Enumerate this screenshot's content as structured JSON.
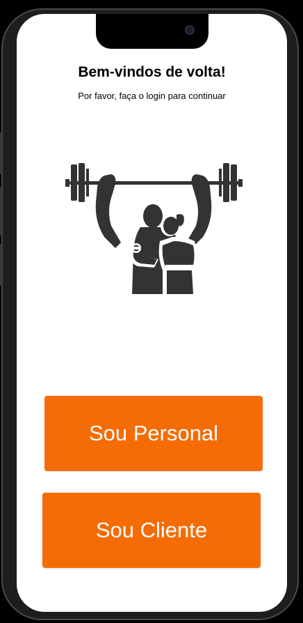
{
  "welcome": {
    "title": "Bem-vindos de volta!",
    "subtitle": "Por favor, faça o login para continuar"
  },
  "illustration": {
    "icon": "fitness-couple-barbell-icon",
    "color": "#333333"
  },
  "actions": {
    "personal_label": "Sou Personal",
    "client_label": "Sou Cliente"
  },
  "colors": {
    "accent": "#f56c07",
    "background": "#ffffff"
  }
}
